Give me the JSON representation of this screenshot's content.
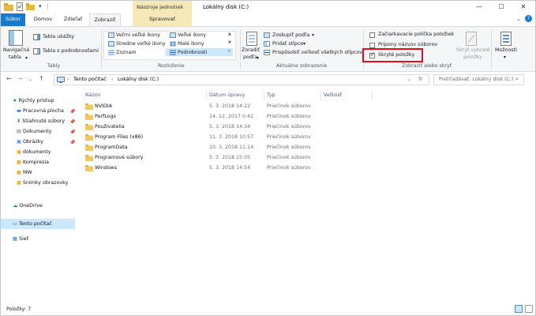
{
  "window": {
    "title": "Lokálny disk (C:)",
    "context_group": "Nástroje jednotiek",
    "controls": {
      "minimize": "—",
      "maximize": "☐",
      "close": "✕"
    },
    "help": "?"
  },
  "tabs": [
    {
      "label": "Súbor"
    },
    {
      "label": "Domov"
    },
    {
      "label": "Zdieľať"
    },
    {
      "label": "Zobraziť"
    },
    {
      "label": "Spravovať"
    }
  ],
  "ribbon": {
    "panes": {
      "nav_pane_1": "Navigačná",
      "nav_pane_2": "tabla",
      "preview": "Tabla ukážky",
      "details_pane": "Tabla s podrobnosťami",
      "group_label": "Tably"
    },
    "layout": {
      "items": {
        "xl_icons": "Veľmi veľké ikony",
        "large_icons": "Veľké ikony",
        "medium_icons": "Stredne veľké ikony",
        "small_icons": "Malé ikony",
        "list": "Zoznam",
        "details": "Podrobnosti"
      },
      "group_label": "Rozloženie"
    },
    "current_view": {
      "sort_1": "Zoradiť",
      "sort_2": "podľa",
      "group_by": "Zoskupiť podľa",
      "add_columns": "Pridať stĺpce",
      "fit_columns": "Prispôsobiť veľkosť všetkých stĺpcov",
      "group_label": "Aktuálne zobrazenie"
    },
    "show_hide": {
      "checkboxes": {
        "label": "Začiarkavacie políčka položiek",
        "checked": false
      },
      "extensions": {
        "label": "Prípony názvov súborov",
        "checked": false
      },
      "hidden_items": {
        "label": "Skryté položky",
        "checked": true
      },
      "hide_selected_1": "Skryť vybraté",
      "hide_selected_2": "položky",
      "group_label": "Zobraziť alebo skryť"
    },
    "options": {
      "label_1": "Možnosti",
      "label_2": "▾"
    }
  },
  "address": {
    "crumbs": [
      "Tento počítač",
      "Lokálny disk (C:)"
    ],
    "search_placeholder": "Prehľadávať: Lokálny disk (C:)"
  },
  "nav_pane": {
    "quick_access": "Rýchly prístup",
    "items": [
      {
        "label": "Pracovná plocha",
        "pinned": true
      },
      {
        "label": "Stiahnuté súbory",
        "pinned": true
      },
      {
        "label": "Dokumenty",
        "pinned": true
      },
      {
        "label": "Obrázky",
        "pinned": true
      },
      {
        "label": "dokumenty",
        "pinned": false
      },
      {
        "label": "Kompresia",
        "pinned": false
      },
      {
        "label": "MW",
        "pinned": false
      },
      {
        "label": "Snímky obrazovky",
        "pinned": false
      }
    ],
    "onedrive": "OneDrive",
    "this_pc": "Tento počítač",
    "network": "Sieť",
    "pin_glyph": "📌"
  },
  "columns": {
    "name": "Názov",
    "date": "Dátum úpravy",
    "type": "Typ",
    "size": "Veľkosť"
  },
  "files": [
    {
      "name": "NVIDIA",
      "date": "5. 3. 2018 14:22",
      "type": "Priečinok súborov"
    },
    {
      "name": "PerfLogs",
      "date": "14. 12. 2017 0:42",
      "type": "Priečinok súborov"
    },
    {
      "name": "Používatelia",
      "date": "5. 3. 2018 14:34",
      "type": "Priečinok súborov"
    },
    {
      "name": "Program Files (x86)",
      "date": "11. 3. 2018 10:57",
      "type": "Priečinok súborov"
    },
    {
      "name": "ProgramData",
      "date": "10. 3. 2018 11:14",
      "type": "Priečinok súborov"
    },
    {
      "name": "Programové súbory",
      "date": "5. 3. 2018 15:05",
      "type": "Priečinok súborov"
    },
    {
      "name": "Windows",
      "date": "5. 3. 2018 14:54",
      "type": "Priečinok súborov"
    }
  ],
  "status": {
    "items_count": "Položky: 7"
  },
  "colors": {
    "accent": "#1979ca",
    "selection": "#cce8ff",
    "context_tab": "#f7e9b7",
    "highlight": "#e2101c"
  }
}
